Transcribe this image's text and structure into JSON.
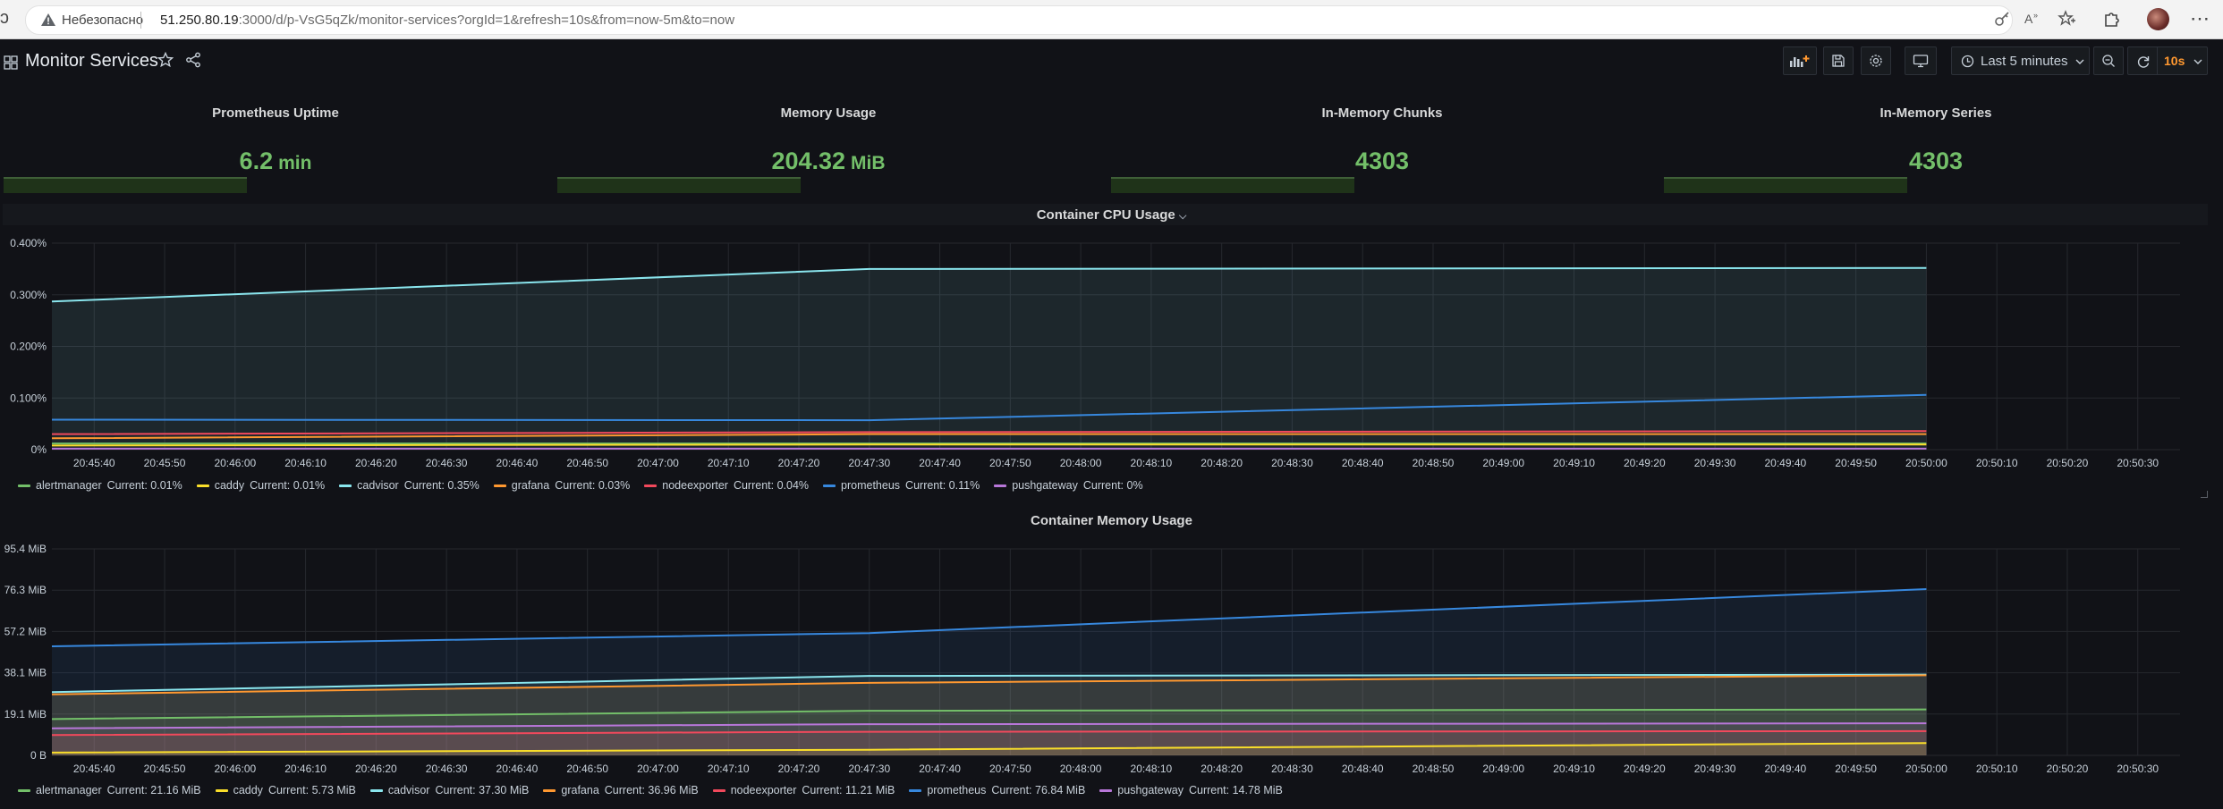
{
  "browser": {
    "security_label": "Небезопасно",
    "url_host": "51.250.80.19",
    "url_path": ":3000/d/p-VsG5qZk/monitor-services?orgId=1&refresh=10s&from=now-5m&to=now"
  },
  "header": {
    "title": "Monitor Services",
    "time_range": "Last 5 minutes",
    "refresh_interval": "10s"
  },
  "stats": [
    {
      "title": "Prometheus Uptime",
      "value": "6.2",
      "unit": "min"
    },
    {
      "title": "Memory Usage",
      "value": "204.32",
      "unit": "MiB"
    },
    {
      "title": "In-Memory Chunks",
      "value": "4303",
      "unit": ""
    },
    {
      "title": "In-Memory Series",
      "value": "4303",
      "unit": ""
    }
  ],
  "cpu_panel": {
    "title": "Container CPU Usage",
    "chevron": "⌵"
  },
  "mem_panel": {
    "title": "Container Memory Usage"
  },
  "cpu_legend": [
    {
      "name": "alertmanager",
      "current": "Current: 0.01%",
      "color": "#73bf69"
    },
    {
      "name": "caddy",
      "current": "Current: 0.01%",
      "color": "#fade2a"
    },
    {
      "name": "cadvisor",
      "current": "Current: 0.35%",
      "color": "#8ae6ee"
    },
    {
      "name": "grafana",
      "current": "Current: 0.03%",
      "color": "#ff9830"
    },
    {
      "name": "nodeexporter",
      "current": "Current: 0.04%",
      "color": "#f2495c"
    },
    {
      "name": "prometheus",
      "current": "Current: 0.11%",
      "color": "#3788de"
    },
    {
      "name": "pushgateway",
      "current": "Current: 0%",
      "color": "#b877d9"
    }
  ],
  "mem_legend": [
    {
      "name": "alertmanager",
      "current": "Current: 21.16 MiB",
      "color": "#73bf69"
    },
    {
      "name": "caddy",
      "current": "Current: 5.73 MiB",
      "color": "#fade2a"
    },
    {
      "name": "cadvisor",
      "current": "Current: 37.30 MiB",
      "color": "#8ae6ee"
    },
    {
      "name": "grafana",
      "current": "Current: 36.96 MiB",
      "color": "#ff9830"
    },
    {
      "name": "nodeexporter",
      "current": "Current: 11.21 MiB",
      "color": "#f2495c"
    },
    {
      "name": "prometheus",
      "current": "Current: 76.84 MiB",
      "color": "#3788de"
    },
    {
      "name": "pushgateway",
      "current": "Current: 14.78 MiB",
      "color": "#b877d9"
    }
  ],
  "chart_data": [
    {
      "type": "line",
      "title": "Container CPU Usage",
      "x_ticks": [
        "20:45:40",
        "20:45:50",
        "20:46:00",
        "20:46:10",
        "20:46:20",
        "20:46:30",
        "20:46:40",
        "20:46:50",
        "20:47:00",
        "20:47:10",
        "20:47:20",
        "20:47:30",
        "20:47:40",
        "20:47:50",
        "20:48:00",
        "20:48:10",
        "20:48:20",
        "20:48:30",
        "20:48:40",
        "20:48:50",
        "20:49:00",
        "20:49:10",
        "20:49:20",
        "20:49:30",
        "20:49:40",
        "20:49:50",
        "20:50:00",
        "20:50:10",
        "20:50:20",
        "20:50:30"
      ],
      "x_range": [
        "20:45:34",
        "20:50:36"
      ],
      "y_ticks": [
        "0%",
        "0.100%",
        "0.200%",
        "0.300%",
        "0.400%"
      ],
      "ylim": [
        0,
        0.4
      ],
      "grid": true,
      "legend_position": "bottom",
      "series": [
        {
          "name": "cadvisor",
          "color": "#8ae6ee",
          "fill": true,
          "points": [
            [
              "20:45:34",
              0.287
            ],
            [
              "20:47:30",
              0.35
            ],
            [
              "20:50:00",
              0.352
            ]
          ]
        },
        {
          "name": "prometheus",
          "color": "#3788de",
          "fill": false,
          "points": [
            [
              "20:45:34",
              0.058
            ],
            [
              "20:47:30",
              0.057
            ],
            [
              "20:50:00",
              0.106
            ]
          ]
        },
        {
          "name": "nodeexporter",
          "color": "#f2495c",
          "fill": false,
          "points": [
            [
              "20:45:34",
              0.03
            ],
            [
              "20:47:30",
              0.034
            ],
            [
              "20:50:00",
              0.036
            ]
          ]
        },
        {
          "name": "grafana",
          "color": "#ff9830",
          "fill": false,
          "points": [
            [
              "20:45:34",
              0.022
            ],
            [
              "20:47:30",
              0.03
            ],
            [
              "20:50:00",
              0.03
            ]
          ]
        },
        {
          "name": "alertmanager",
          "color": "#73bf69",
          "fill": false,
          "points": [
            [
              "20:45:34",
              0.012
            ],
            [
              "20:47:30",
              0.012
            ],
            [
              "20:50:00",
              0.012
            ]
          ]
        },
        {
          "name": "caddy",
          "color": "#fade2a",
          "fill": false,
          "points": [
            [
              "20:45:34",
              0.008
            ],
            [
              "20:47:30",
              0.01
            ],
            [
              "20:50:00",
              0.01
            ]
          ]
        },
        {
          "name": "pushgateway",
          "color": "#b877d9",
          "fill": false,
          "points": [
            [
              "20:45:34",
              0.002
            ],
            [
              "20:47:30",
              0.002
            ],
            [
              "20:50:00",
              0.002
            ]
          ]
        }
      ]
    },
    {
      "type": "line",
      "title": "Container Memory Usage",
      "x_ticks": [
        "20:45:40",
        "20:45:50",
        "20:46:00",
        "20:46:10",
        "20:46:20",
        "20:46:30",
        "20:46:40",
        "20:46:50",
        "20:47:00",
        "20:47:10",
        "20:47:20",
        "20:47:30",
        "20:47:40",
        "20:47:50",
        "20:48:00",
        "20:48:10",
        "20:48:20",
        "20:48:30",
        "20:48:40",
        "20:48:50",
        "20:49:00",
        "20:49:10",
        "20:49:20",
        "20:49:30",
        "20:49:40",
        "20:49:50",
        "20:50:00",
        "20:50:10",
        "20:50:20",
        "20:50:30"
      ],
      "x_range": [
        "20:45:34",
        "20:50:36"
      ],
      "y_ticks": [
        "0 B",
        "19.1 MiB",
        "38.1 MiB",
        "57.2 MiB",
        "76.3 MiB",
        "95.4 MiB"
      ],
      "ylim": [
        0,
        95.4
      ],
      "grid": true,
      "legend_position": "bottom",
      "series": [
        {
          "name": "prometheus",
          "color": "#3788de",
          "fill": true,
          "points": [
            [
              "20:45:34",
              50.4
            ],
            [
              "20:47:30",
              56.5
            ],
            [
              "20:50:00",
              76.8
            ]
          ]
        },
        {
          "name": "cadvisor",
          "color": "#8ae6ee",
          "fill": true,
          "points": [
            [
              "20:45:34",
              29.2
            ],
            [
              "20:47:30",
              36.7
            ],
            [
              "20:50:00",
              37.3
            ]
          ]
        },
        {
          "name": "grafana",
          "color": "#ff9830",
          "fill": true,
          "points": [
            [
              "20:45:34",
              28.2
            ],
            [
              "20:47:30",
              33.5
            ],
            [
              "20:50:00",
              37.0
            ]
          ]
        },
        {
          "name": "alertmanager",
          "color": "#73bf69",
          "fill": true,
          "points": [
            [
              "20:45:34",
              16.8
            ],
            [
              "20:47:30",
              20.6
            ],
            [
              "20:50:00",
              21.2
            ]
          ]
        },
        {
          "name": "pushgateway",
          "color": "#b877d9",
          "fill": true,
          "points": [
            [
              "20:45:34",
              12.5
            ],
            [
              "20:47:30",
              14.4
            ],
            [
              "20:50:00",
              14.8
            ]
          ]
        },
        {
          "name": "nodeexporter",
          "color": "#f2495c",
          "fill": true,
          "points": [
            [
              "20:45:34",
              9.4
            ],
            [
              "20:47:30",
              10.9
            ],
            [
              "20:50:00",
              11.2
            ]
          ]
        },
        {
          "name": "caddy",
          "color": "#fade2a",
          "fill": true,
          "points": [
            [
              "20:45:34",
              1.3
            ],
            [
              "20:47:30",
              2.6
            ],
            [
              "20:50:00",
              5.7
            ]
          ]
        }
      ]
    }
  ]
}
